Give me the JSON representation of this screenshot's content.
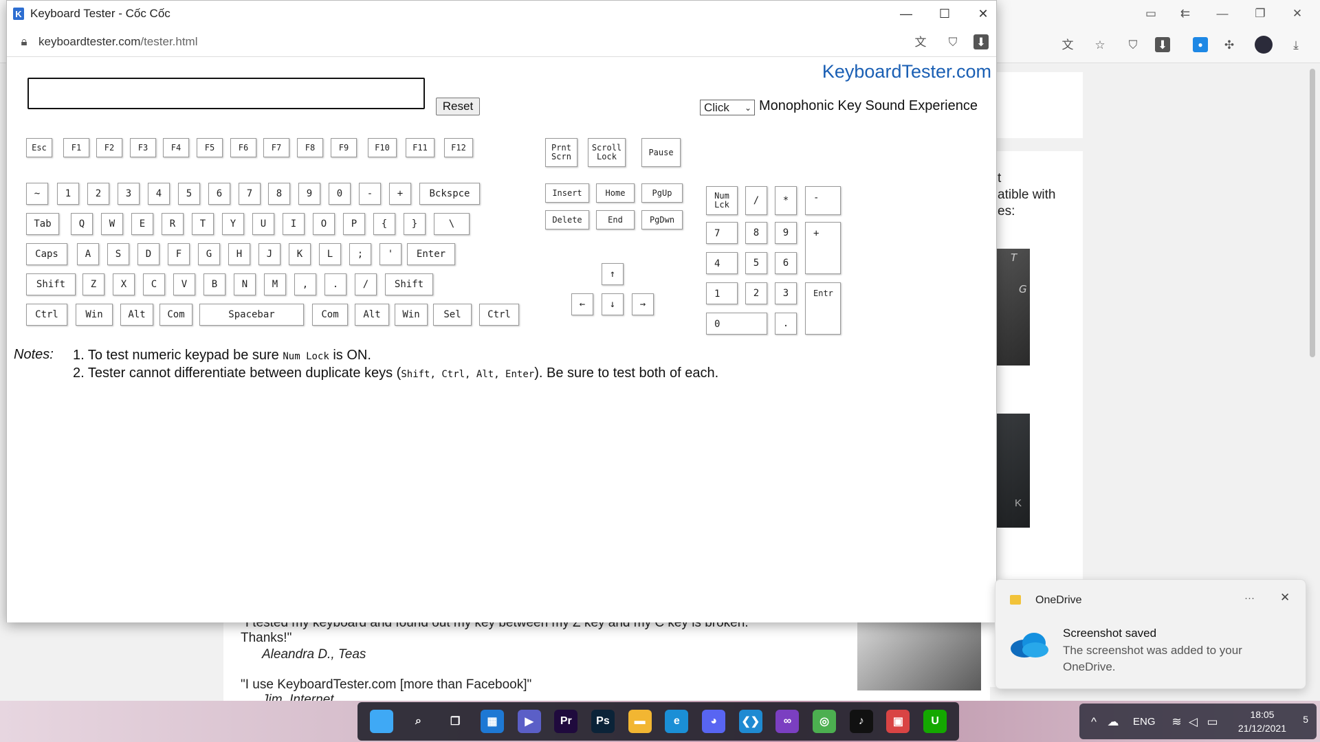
{
  "front_window": {
    "title": "Keyboard Tester - Cốc Cốc",
    "logo_letter": "K",
    "url_domain": "keyboardtester.com",
    "url_path": "/tester.html"
  },
  "tester": {
    "brand": "KeyboardTester.com",
    "reset_label": "Reset",
    "sound_option": "Click",
    "sound_label": "Monophonic Key Sound Experience",
    "function_row": [
      "Esc",
      "F1",
      "F2",
      "F3",
      "F4",
      "F5",
      "F6",
      "F7",
      "F8",
      "F9",
      "F10",
      "F11",
      "F12"
    ],
    "system_keys": [
      "Prnt\nScrn",
      "Scroll\nLock",
      "Pause"
    ],
    "number_row": [
      "~",
      "1",
      "2",
      "3",
      "4",
      "5",
      "6",
      "7",
      "8",
      "9",
      "0",
      "-",
      "+",
      "Bckspce"
    ],
    "top_row": [
      "Tab",
      "Q",
      "W",
      "E",
      "R",
      "T",
      "Y",
      "U",
      "I",
      "O",
      "P",
      "{",
      "}",
      "\\"
    ],
    "home_row": [
      "Caps",
      "A",
      "S",
      "D",
      "F",
      "G",
      "H",
      "J",
      "K",
      "L",
      ";",
      "'",
      "Enter"
    ],
    "shift_row": [
      "Shift",
      "Z",
      "X",
      "C",
      "V",
      "B",
      "N",
      "M",
      ",",
      ".",
      "/",
      "Shift"
    ],
    "bottom_row": [
      "Ctrl",
      "Win",
      "Alt",
      "Com",
      "Spacebar",
      "Com",
      "Alt",
      "Win",
      "Sel",
      "Ctrl"
    ],
    "nav_keys": [
      "Insert",
      "Home",
      "PgUp",
      "Delete",
      "End",
      "PgDwn"
    ],
    "arrow_keys": [
      "↑",
      "←",
      "↓",
      "→"
    ],
    "numpad": [
      "Num\nLck",
      "/",
      "*",
      "-",
      "7",
      "8",
      "9",
      "+",
      "4",
      "5",
      "6",
      "1",
      "2",
      "3",
      "Entr",
      "0",
      "."
    ],
    "notes_label": "Notes:",
    "note1_pre": "1. To test numeric keypad be sure ",
    "note1_code": "Num Lock",
    "note1_post": " is ON.",
    "note2_pre": "2. Tester cannot differentiate between duplicate keys (",
    "note2_code": "Shift, Ctrl, Alt, Enter",
    "note2_post": "). Be sure to test both of each."
  },
  "background_page": {
    "side_text": "t\natible with\nes:",
    "photo_letters": [
      "T",
      "G",
      "K"
    ],
    "quote1": "\"I tested my keyboard and found out my key between my Z key and my C key is broken.",
    "quote1_cont": "Thanks!\"",
    "author1": "Aleandra D., Teas",
    "quote2": "\"I use KeyboardTester.com [more than Facebook]\"",
    "author2": "Jim, Internet"
  },
  "toast": {
    "app": "OneDrive",
    "more": "···",
    "title": "Screenshot saved",
    "body": "The screenshot was added to your OneDrive."
  },
  "taskbar": {
    "lang": "ENG",
    "time": "18:05",
    "date": "21/12/2021",
    "notification_count": "5",
    "apps": [
      {
        "name": "start",
        "label": "",
        "color": "#3fa9f5"
      },
      {
        "name": "search",
        "label": "⌕",
        "color": "transparent"
      },
      {
        "name": "task-view",
        "label": "❐",
        "color": "transparent"
      },
      {
        "name": "widgets",
        "label": "▦",
        "color": "#1e78d4"
      },
      {
        "name": "teams",
        "label": "▶",
        "color": "#5b5fc7"
      },
      {
        "name": "premiere",
        "label": "Pr",
        "color": "#1f0a3d"
      },
      {
        "name": "photoshop",
        "label": "Ps",
        "color": "#0b2338"
      },
      {
        "name": "explorer",
        "label": "▬",
        "color": "#f2b632"
      },
      {
        "name": "edge",
        "label": "e",
        "color": "#1b8fd6"
      },
      {
        "name": "discord",
        "label": "◕",
        "color": "#5865f2"
      },
      {
        "name": "vscode",
        "label": "❮❯",
        "color": "#1f8ad2"
      },
      {
        "name": "visual-studio",
        "label": "∞",
        "color": "#7b3fc1"
      },
      {
        "name": "coccoc",
        "label": "◎",
        "color": "#4caf50"
      },
      {
        "name": "tiktok",
        "label": "♪",
        "color": "#111"
      },
      {
        "name": "app-grid",
        "label": "▣",
        "color": "#d94444"
      },
      {
        "name": "upwork",
        "label": "U",
        "color": "#14a800"
      }
    ]
  }
}
